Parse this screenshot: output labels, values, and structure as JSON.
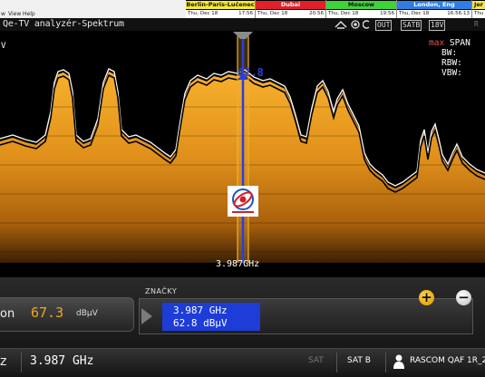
{
  "menu": {
    "items": [
      "w",
      "View",
      "Help"
    ]
  },
  "clocks": [
    {
      "city": "Berlin-Paris-Lučenec",
      "date": "Thu, Dec 18",
      "time": "17:56",
      "bg": "#f7ea33",
      "fg": "#111111"
    },
    {
      "city": "Dubai",
      "date": "Thu, Dec 18",
      "time": "20:56",
      "bg": "#e0202a",
      "fg": "#ffffff"
    },
    {
      "city": "Moscow",
      "date": "Thu, Dec 18",
      "time": "19:56",
      "bg": "#3fd33a",
      "fg": "#111111"
    },
    {
      "city": "London, Eng",
      "date": "Thu, Dec 18",
      "time": "16:56:13",
      "bg": "#2f7ee6",
      "fg": "#ffffff"
    },
    {
      "city": "Jer",
      "date": "Thu",
      "time": "",
      "bg": "#f3e64a",
      "fg": "#111111"
    }
  ],
  "title": "Qe-TV analyzér-Spektrum",
  "status_icons": {
    "out": "OUT",
    "satb": "SATB",
    "v18": "18V",
    "tail": "R"
  },
  "readouts": {
    "max": "max",
    "span": "SPAN",
    "bw": "BW:",
    "rbw": "RBW:",
    "vbw": "VBW:"
  },
  "left_label": "V",
  "peak_value": "62.8",
  "marker_freq": "3.987GHz",
  "panel": {
    "level_label": "on",
    "level_value": "67.3",
    "level_unit": "dBµV",
    "markers_title": "ZNAČKY",
    "marker_freq": "3.987 GHz",
    "marker_level": "62.8 dBµV"
  },
  "statusbar": {
    "unit_fragment": "z",
    "frequency": "3.987 GHz",
    "sat_icon": "SAT",
    "sat": "SAT B",
    "name": "RASCOM QAF 1R_2"
  },
  "colors": {
    "trace_fill": "#f0a020",
    "marker_line": "#2a3fe0",
    "marker_band": "#f0b030",
    "accent": "#f0a61c"
  },
  "icons": [
    "grip-icon",
    "signal-icon",
    "record-icon",
    "settings-icon",
    "zoom-in-icon",
    "zoom-out-icon",
    "user-icon",
    "satellite-icon",
    "app-logo-icon"
  ]
}
